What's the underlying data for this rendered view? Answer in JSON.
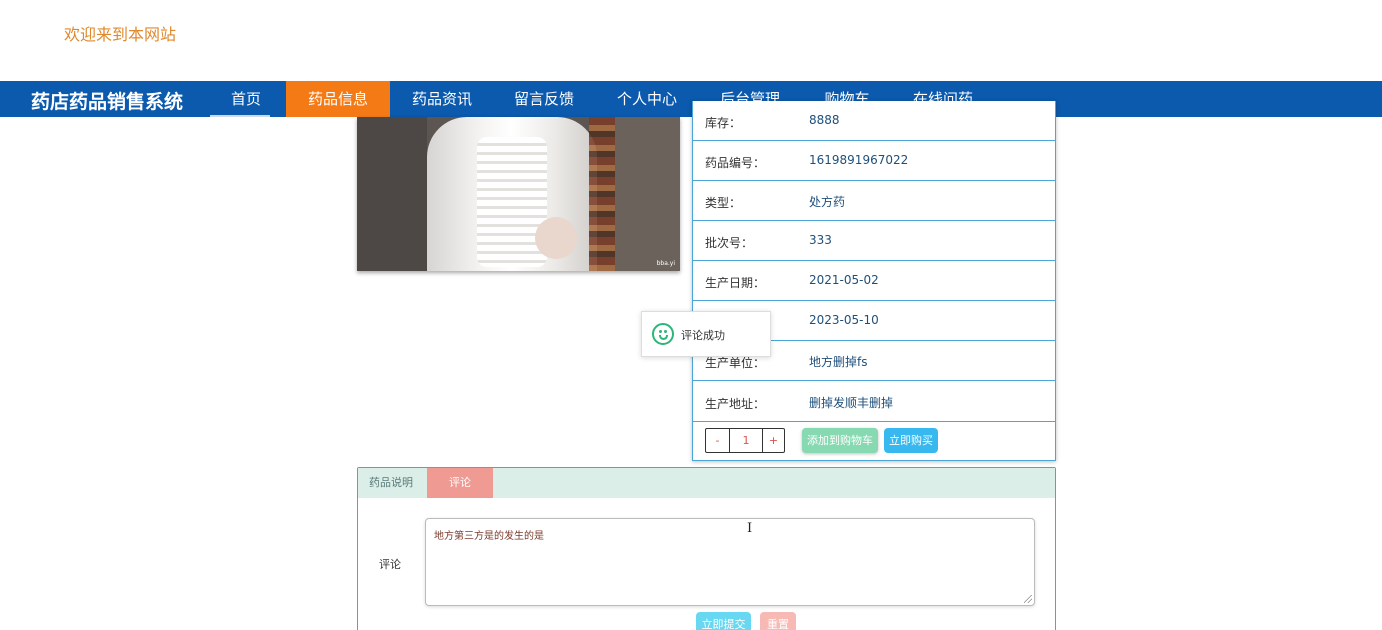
{
  "header": {
    "welcome": "欢迎来到本网站"
  },
  "navbar": {
    "brand": "药店药品销售系统",
    "items": [
      {
        "label": "首页",
        "active": false
      },
      {
        "label": "药品信息",
        "active": true
      },
      {
        "label": "药品资讯",
        "active": false
      },
      {
        "label": "留言反馈",
        "active": false
      },
      {
        "label": "个人中心",
        "active": false
      },
      {
        "label": "后台管理",
        "active": false
      },
      {
        "label": "购物车",
        "active": false
      },
      {
        "label": "在线问药",
        "active": false
      }
    ]
  },
  "product_image": {
    "watermark": "bba.yi"
  },
  "details": {
    "rows": [
      {
        "label": "库存：",
        "value": "8888"
      },
      {
        "label": "药品编号：",
        "value": "1619891967022"
      },
      {
        "label": "类型：",
        "value": "处方药"
      },
      {
        "label": "批次号：",
        "value": "333"
      },
      {
        "label": "生产日期：",
        "value": "2021-05-02"
      },
      {
        "label": "",
        "value": "2023-05-10"
      },
      {
        "label": "生产单位：",
        "value": "地方删掉fs"
      },
      {
        "label": "生产地址：",
        "value": "删掉发顺丰删掉"
      }
    ],
    "quantity": {
      "minus": "-",
      "value": "1",
      "plus": "+"
    },
    "add_to_cart": "添加到购物车",
    "buy_now": "立即购买"
  },
  "toast": {
    "message": "评论成功",
    "icon": "smile-icon"
  },
  "tabs": {
    "items": [
      {
        "label": "药品说明",
        "active": false
      },
      {
        "label": "评论",
        "active": true
      }
    ],
    "comment_label": "评论",
    "comment_value": "地方第三方是的发生的是",
    "submit": "立即提交",
    "reset": "重置"
  },
  "colors": {
    "navbar": "#0b5aad",
    "nav_active": "#f47a16",
    "welcome_text": "#e0892c",
    "table_border": "#4aa6d6",
    "cart_button": "#86d9b0",
    "buy_button": "#37b8ef",
    "active_tab": "#ef9a93"
  }
}
